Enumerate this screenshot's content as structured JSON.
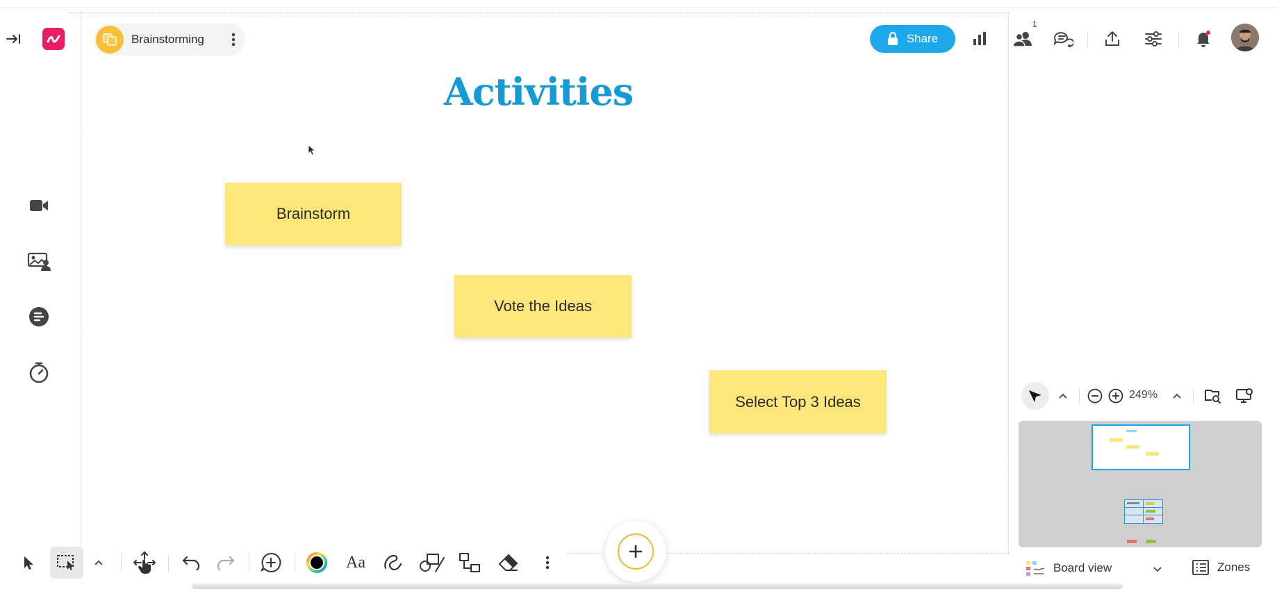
{
  "board": {
    "name": "Brainstorming",
    "title": "Activities"
  },
  "header": {
    "share_label": "Share",
    "participants_count": "1"
  },
  "stickies": [
    {
      "text": "Brainstorm"
    },
    {
      "text": "Vote the Ideas"
    },
    {
      "text": "Select Top 3 Ideas"
    }
  ],
  "zoom": {
    "level": "249%"
  },
  "footer": {
    "board_view_label": "Board view",
    "zones_label": "Zones"
  },
  "colors": {
    "accent": "#1ea7ea",
    "title": "#169ad6",
    "sticky": "#fde67a",
    "brand": "#e91e63",
    "board_logo": "#f7be38",
    "notification_dot": "#e91e63"
  },
  "icons": {
    "collapse": "collapse-arrow-icon",
    "app_logo": "app-logo-icon",
    "board_menu": "more-vertical-icon",
    "lock": "lock-icon",
    "analytics": "bar-chart-icon",
    "participants": "users-icon",
    "comments": "chat-icon",
    "export": "upload-icon",
    "settings": "sliders-icon",
    "notifications": "bell-icon",
    "video": "video-camera-icon",
    "present": "presentation-icon",
    "agenda": "agenda-icon",
    "timer": "timer-icon"
  }
}
